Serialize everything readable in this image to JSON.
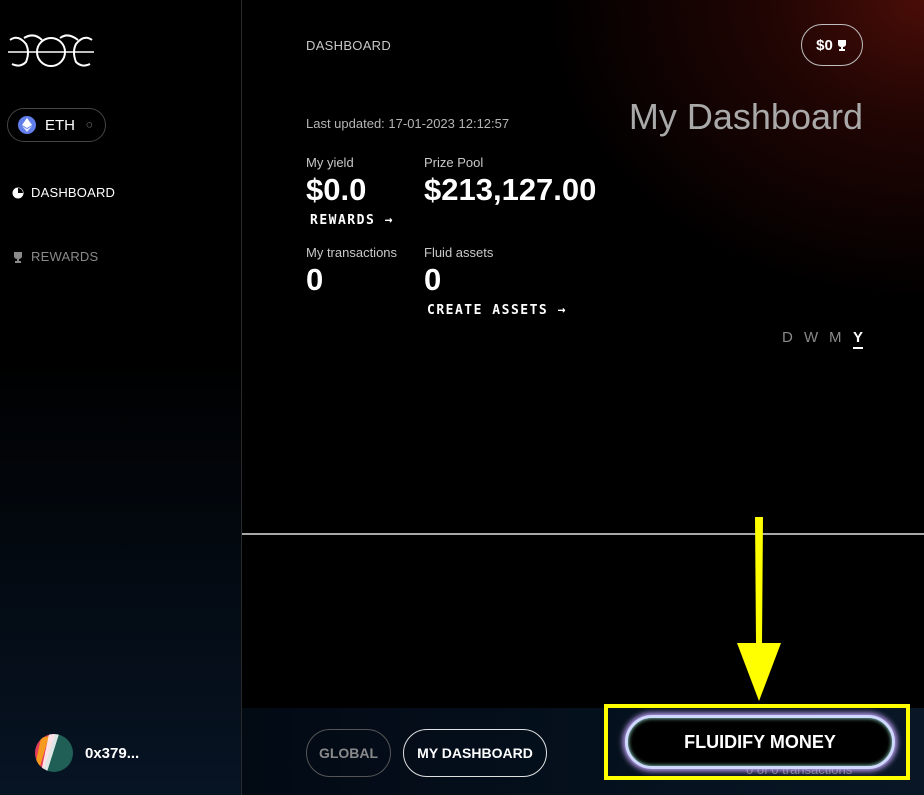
{
  "sidebar": {
    "chain": {
      "label": "ETH"
    },
    "nav": [
      {
        "label": "DASHBOARD",
        "active": true
      },
      {
        "label": "REWARDS",
        "active": false
      }
    ],
    "wallet": {
      "address": "0x379..."
    }
  },
  "header": {
    "breadcrumb": "DASHBOARD",
    "balance": "$0"
  },
  "main": {
    "title": "My Dashboard",
    "last_updated": "Last updated: 17-01-2023 12:12:57",
    "stats": {
      "my_yield": {
        "label": "My yield",
        "value": "$0.0",
        "link": "REWARDS"
      },
      "prize_pool": {
        "label": "Prize Pool",
        "value": "$213,127.00"
      },
      "my_transactions": {
        "label": "My transactions",
        "value": "0"
      },
      "fluid_assets": {
        "label": "Fluid assets",
        "value": "0",
        "link": "CREATE ASSETS"
      }
    },
    "periods": [
      "D",
      "W",
      "M",
      "Y"
    ],
    "active_period": "Y"
  },
  "footer": {
    "global_label": "GLOBAL",
    "my_dashboard_label": "MY DASHBOARD",
    "fluidify_label": "FLUIDIFY MONEY",
    "transactions_text": "0 of 0 transactions"
  },
  "colors": {
    "highlight": "#ffff00",
    "accent_red": "#4a0d08",
    "eth_blue": "#627eea"
  },
  "icons": [
    "eth-icon",
    "spinner-icon",
    "dashboard-icon",
    "trophy-icon",
    "arrow-right-icon",
    "annotation-arrow-icon"
  ]
}
